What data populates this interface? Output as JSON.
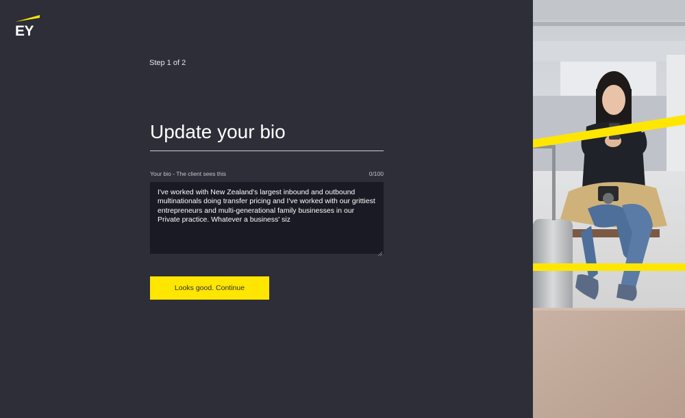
{
  "brand": {
    "logo_text": "EY",
    "accent_color": "#ffe600",
    "background_color": "#2e2e38"
  },
  "step": {
    "label": "Step 1 of 2"
  },
  "page": {
    "title": "Update your bio"
  },
  "bio": {
    "label": "Your bio - The client sees this",
    "counter": "0/100",
    "value": "I've worked with New Zealand's largest inbound and outbound multinationals doing transfer pricing and I've worked with our grittiest entrepreneurs and multi-generational family businesses in our Private practice. Whatever a business' siz"
  },
  "actions": {
    "continue_label": "Looks good. Continue"
  },
  "photo": {
    "subject": "woman-with-phone-at-airport-photo"
  }
}
